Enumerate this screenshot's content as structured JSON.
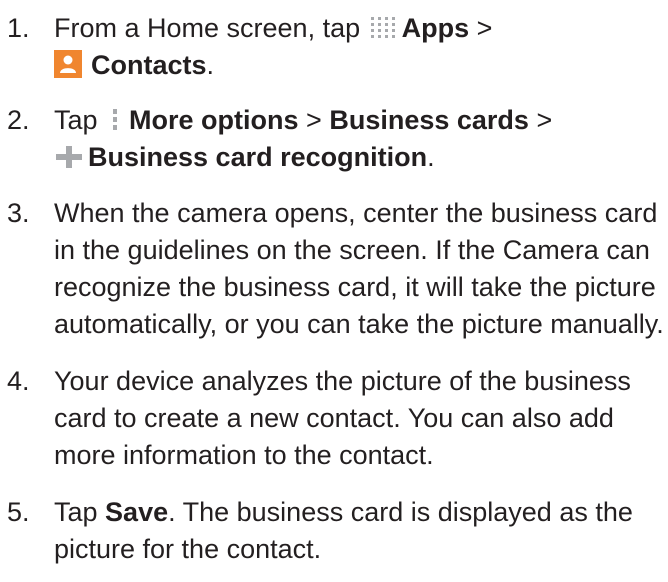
{
  "steps": [
    {
      "number": "1.",
      "text_before": "From a Home screen, tap ",
      "apps_label": "Apps",
      "sep1": " >",
      "contacts_label": "Contacts",
      "end": "."
    },
    {
      "number": "2.",
      "text_before": "Tap ",
      "more_options_label": "More options",
      "sep1": " > ",
      "business_cards_label": "Business cards",
      "sep2": " >",
      "recognition_label": "Business card recognition",
      "end": "."
    },
    {
      "number": "3.",
      "text": "When the camera opens, center the business card in the guidelines on the screen. If the Camera can recognize the business card, it will take the picture automatically, or you can take the picture manually."
    },
    {
      "number": "4.",
      "text": "Your device analyzes the picture of the business card to create a new contact. You can also add more information to the contact."
    },
    {
      "number": "5.",
      "text_before": "Tap ",
      "save_label": "Save",
      "text_after": ". The business card is displayed as the picture for the contact."
    }
  ],
  "icons": {
    "apps": "apps-grid-icon",
    "contacts": "contacts-icon",
    "more_options": "more-options-icon",
    "add": "plus-icon"
  },
  "colors": {
    "text": "#231f20",
    "contacts_icon": "#f0862f",
    "icon_gray": "#a7a9ac"
  }
}
